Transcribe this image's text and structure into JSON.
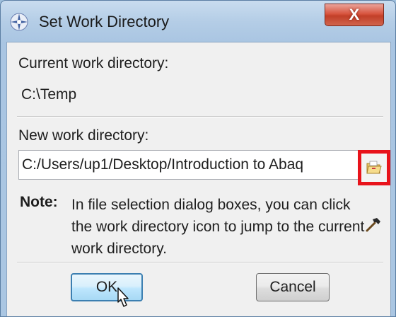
{
  "window": {
    "title": "Set Work Directory",
    "icon": "abaqus-app-icon",
    "close_label": "X"
  },
  "current": {
    "label": "Current work directory:",
    "value": "C:\\Temp"
  },
  "new_dir": {
    "label": "New work directory:",
    "value": "C:/Users/up1/Desktop/Introduction to Abaq",
    "browse_icon": "folder-open-icon"
  },
  "note": {
    "label": "Note:",
    "text": "In file selection dialog boxes, you can click the work directory icon to jump to the current work directory.",
    "icon": "hammer-icon"
  },
  "buttons": {
    "ok_label": "OK",
    "cancel_label": "Cancel"
  },
  "colors": {
    "highlight": "#e8131b",
    "close_button": "#c94a35"
  }
}
